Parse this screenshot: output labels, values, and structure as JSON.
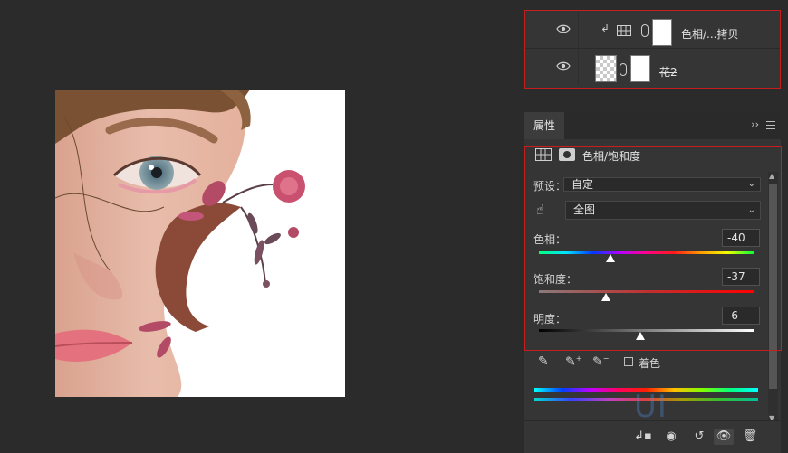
{
  "layers": [
    {
      "name": "色相/...拷贝",
      "type": "adjustment",
      "clipped": true,
      "clip_glyph": "↲"
    },
    {
      "name": "花2",
      "type": "smart-object",
      "clipped": false
    }
  ],
  "properties": {
    "tab_label": "属性",
    "collapse_glyph": "››",
    "panel_title": "色相/饱和度",
    "preset": {
      "label": "预设：",
      "value": "自定"
    },
    "range": {
      "value": "全图"
    },
    "sliders": [
      {
        "label": "色相：",
        "value": "-40",
        "level": 0.33
      },
      {
        "label": "饱和度：",
        "value": "-37",
        "level": 0.31
      },
      {
        "label": "明度：",
        "value": "-6",
        "level": 0.47
      }
    ],
    "colorize": {
      "label": "着色",
      "checked": false
    },
    "bottom_buttons": [
      "clip-to-layer",
      "view-previous",
      "reset",
      "toggle-visibility",
      "delete"
    ]
  },
  "colors": {
    "highlight_border": "#c41e1e",
    "panel_bg": "#353535",
    "app_bg": "#2b2b2b"
  }
}
